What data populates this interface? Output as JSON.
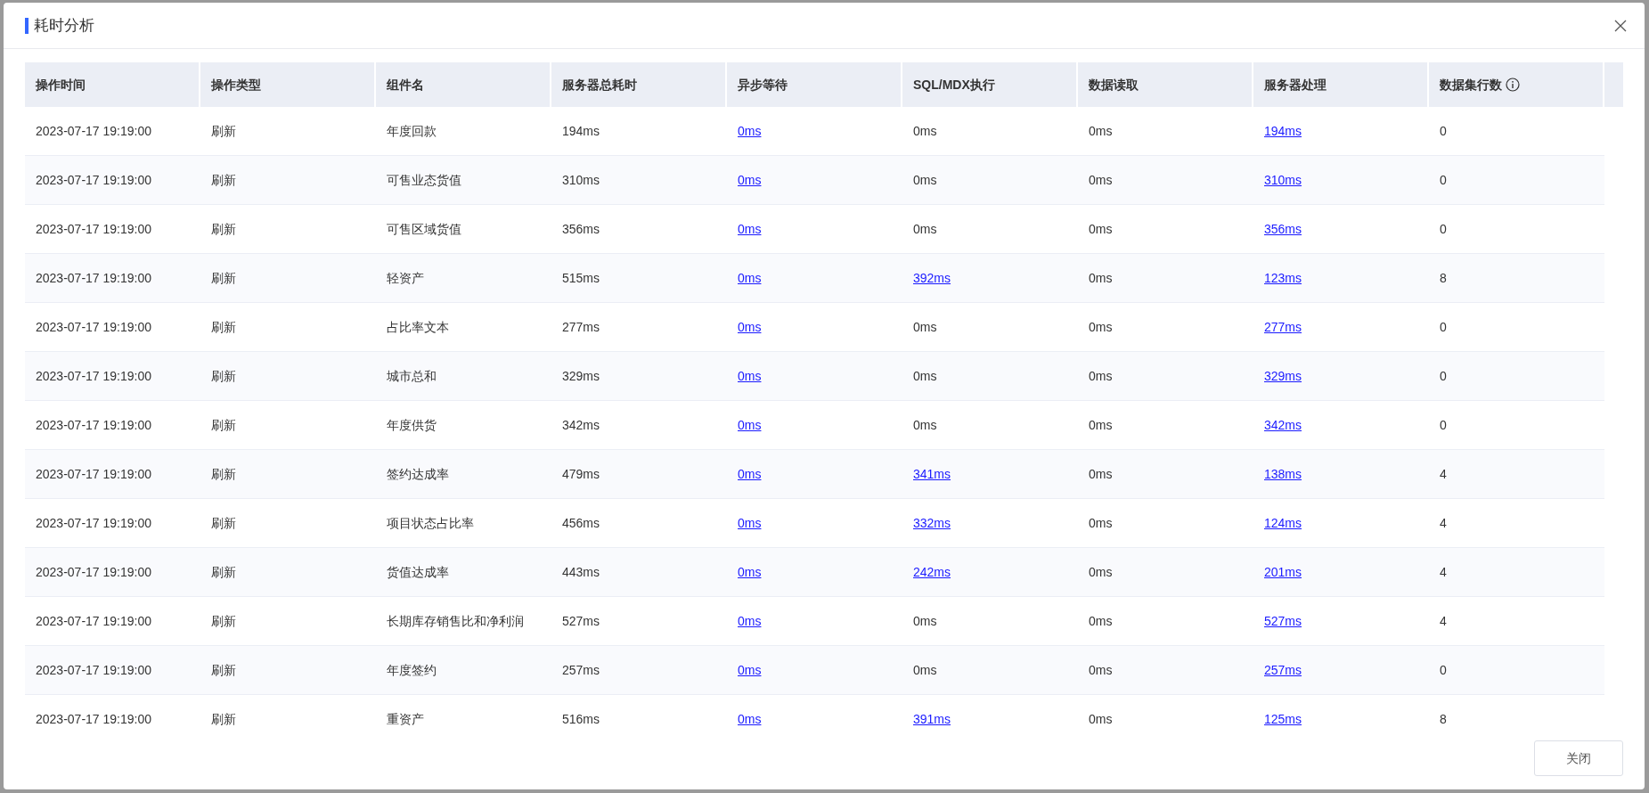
{
  "dialog": {
    "title": "耗时分析",
    "close_button": "关闭"
  },
  "table": {
    "columns": [
      {
        "label": "操作时间",
        "info": false
      },
      {
        "label": "操作类型",
        "info": false
      },
      {
        "label": "组件名",
        "info": false
      },
      {
        "label": "服务器总耗时",
        "info": false
      },
      {
        "label": "异步等待",
        "info": false
      },
      {
        "label": "SQL/MDX执行",
        "info": false
      },
      {
        "label": "数据读取",
        "info": false
      },
      {
        "label": "服务器处理",
        "info": false
      },
      {
        "label": "数据集行数",
        "info": true
      }
    ],
    "rows": [
      {
        "cells": [
          {
            "text": "2023-07-17 19:19:00",
            "link": false
          },
          {
            "text": "刷新",
            "link": false
          },
          {
            "text": "年度回款",
            "link": false
          },
          {
            "text": "194ms",
            "link": false
          },
          {
            "text": "0ms",
            "link": true
          },
          {
            "text": "0ms",
            "link": false
          },
          {
            "text": "0ms",
            "link": false
          },
          {
            "text": "194ms",
            "link": true
          },
          {
            "text": "0",
            "link": false
          }
        ]
      },
      {
        "cells": [
          {
            "text": "2023-07-17 19:19:00",
            "link": false
          },
          {
            "text": "刷新",
            "link": false
          },
          {
            "text": "可售业态货值",
            "link": false
          },
          {
            "text": "310ms",
            "link": false
          },
          {
            "text": "0ms",
            "link": true
          },
          {
            "text": "0ms",
            "link": false
          },
          {
            "text": "0ms",
            "link": false
          },
          {
            "text": "310ms",
            "link": true
          },
          {
            "text": "0",
            "link": false
          }
        ]
      },
      {
        "cells": [
          {
            "text": "2023-07-17 19:19:00",
            "link": false
          },
          {
            "text": "刷新",
            "link": false
          },
          {
            "text": "可售区域货值",
            "link": false
          },
          {
            "text": "356ms",
            "link": false
          },
          {
            "text": "0ms",
            "link": true
          },
          {
            "text": "0ms",
            "link": false
          },
          {
            "text": "0ms",
            "link": false
          },
          {
            "text": "356ms",
            "link": true
          },
          {
            "text": "0",
            "link": false
          }
        ]
      },
      {
        "cells": [
          {
            "text": "2023-07-17 19:19:00",
            "link": false
          },
          {
            "text": "刷新",
            "link": false
          },
          {
            "text": "轻资产",
            "link": false
          },
          {
            "text": "515ms",
            "link": false
          },
          {
            "text": "0ms",
            "link": true
          },
          {
            "text": "392ms",
            "link": true
          },
          {
            "text": "0ms",
            "link": false
          },
          {
            "text": "123ms",
            "link": true
          },
          {
            "text": "8",
            "link": false
          }
        ]
      },
      {
        "cells": [
          {
            "text": "2023-07-17 19:19:00",
            "link": false
          },
          {
            "text": "刷新",
            "link": false
          },
          {
            "text": "占比率文本",
            "link": false
          },
          {
            "text": "277ms",
            "link": false
          },
          {
            "text": "0ms",
            "link": true
          },
          {
            "text": "0ms",
            "link": false
          },
          {
            "text": "0ms",
            "link": false
          },
          {
            "text": "277ms",
            "link": true
          },
          {
            "text": "0",
            "link": false
          }
        ]
      },
      {
        "cells": [
          {
            "text": "2023-07-17 19:19:00",
            "link": false
          },
          {
            "text": "刷新",
            "link": false
          },
          {
            "text": "城市总和",
            "link": false
          },
          {
            "text": "329ms",
            "link": false
          },
          {
            "text": "0ms",
            "link": true
          },
          {
            "text": "0ms",
            "link": false
          },
          {
            "text": "0ms",
            "link": false
          },
          {
            "text": "329ms",
            "link": true
          },
          {
            "text": "0",
            "link": false
          }
        ]
      },
      {
        "cells": [
          {
            "text": "2023-07-17 19:19:00",
            "link": false
          },
          {
            "text": "刷新",
            "link": false
          },
          {
            "text": "年度供货",
            "link": false
          },
          {
            "text": "342ms",
            "link": false
          },
          {
            "text": "0ms",
            "link": true
          },
          {
            "text": "0ms",
            "link": false
          },
          {
            "text": "0ms",
            "link": false
          },
          {
            "text": "342ms",
            "link": true
          },
          {
            "text": "0",
            "link": false
          }
        ]
      },
      {
        "cells": [
          {
            "text": "2023-07-17 19:19:00",
            "link": false
          },
          {
            "text": "刷新",
            "link": false
          },
          {
            "text": "签约达成率",
            "link": false
          },
          {
            "text": "479ms",
            "link": false
          },
          {
            "text": "0ms",
            "link": true
          },
          {
            "text": "341ms",
            "link": true
          },
          {
            "text": "0ms",
            "link": false
          },
          {
            "text": "138ms",
            "link": true
          },
          {
            "text": "4",
            "link": false
          }
        ]
      },
      {
        "cells": [
          {
            "text": "2023-07-17 19:19:00",
            "link": false
          },
          {
            "text": "刷新",
            "link": false
          },
          {
            "text": "项目状态占比率",
            "link": false
          },
          {
            "text": "456ms",
            "link": false
          },
          {
            "text": "0ms",
            "link": true
          },
          {
            "text": "332ms",
            "link": true
          },
          {
            "text": "0ms",
            "link": false
          },
          {
            "text": "124ms",
            "link": true
          },
          {
            "text": "4",
            "link": false
          }
        ]
      },
      {
        "cells": [
          {
            "text": "2023-07-17 19:19:00",
            "link": false
          },
          {
            "text": "刷新",
            "link": false
          },
          {
            "text": "货值达成率",
            "link": false
          },
          {
            "text": "443ms",
            "link": false
          },
          {
            "text": "0ms",
            "link": true
          },
          {
            "text": "242ms",
            "link": true
          },
          {
            "text": "0ms",
            "link": false
          },
          {
            "text": "201ms",
            "link": true
          },
          {
            "text": "4",
            "link": false
          }
        ]
      },
      {
        "cells": [
          {
            "text": "2023-07-17 19:19:00",
            "link": false
          },
          {
            "text": "刷新",
            "link": false
          },
          {
            "text": "长期库存销售比和净利润",
            "link": false
          },
          {
            "text": "527ms",
            "link": false
          },
          {
            "text": "0ms",
            "link": true
          },
          {
            "text": "0ms",
            "link": false
          },
          {
            "text": "0ms",
            "link": false
          },
          {
            "text": "527ms",
            "link": true
          },
          {
            "text": "4",
            "link": false
          }
        ]
      },
      {
        "cells": [
          {
            "text": "2023-07-17 19:19:00",
            "link": false
          },
          {
            "text": "刷新",
            "link": false
          },
          {
            "text": "年度签约",
            "link": false
          },
          {
            "text": "257ms",
            "link": false
          },
          {
            "text": "0ms",
            "link": true
          },
          {
            "text": "0ms",
            "link": false
          },
          {
            "text": "0ms",
            "link": false
          },
          {
            "text": "257ms",
            "link": true
          },
          {
            "text": "0",
            "link": false
          }
        ]
      },
      {
        "cells": [
          {
            "text": "2023-07-17 19:19:00",
            "link": false
          },
          {
            "text": "刷新",
            "link": false
          },
          {
            "text": "重资产",
            "link": false
          },
          {
            "text": "516ms",
            "link": false
          },
          {
            "text": "0ms",
            "link": true
          },
          {
            "text": "391ms",
            "link": true
          },
          {
            "text": "0ms",
            "link": false
          },
          {
            "text": "125ms",
            "link": true
          },
          {
            "text": "8",
            "link": false
          }
        ]
      }
    ]
  }
}
